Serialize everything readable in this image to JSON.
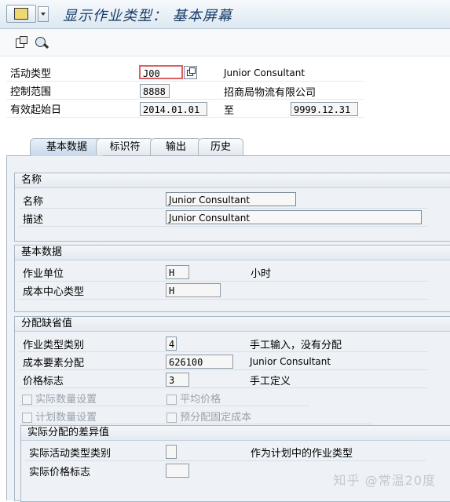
{
  "window": {
    "title": "显示作业类型： 基本屏幕"
  },
  "header": {
    "activity_type": {
      "label": "活动类型",
      "value": "J00",
      "text": "Junior Consultant"
    },
    "controlling_area": {
      "label": "控制范围",
      "value": "8888",
      "text": "招商局物流有限公司"
    },
    "valid_from": {
      "label": "有效起始日",
      "value": "2014.01.01",
      "to_label": "至",
      "to_value": "9999.12.31"
    }
  },
  "tabs": [
    {
      "label": "基本数据",
      "active": true
    },
    {
      "label": "标识符",
      "active": false
    },
    {
      "label": "输出",
      "active": false
    },
    {
      "label": "历史",
      "active": false
    }
  ],
  "group_name": {
    "title": "名称",
    "name_label": "名称",
    "name_value": "Junior Consultant",
    "desc_label": "描述",
    "desc_value": "Junior Consultant"
  },
  "group_basic": {
    "title": "基本数据",
    "unit_label": "作业单位",
    "unit_value": "H",
    "unit_text": "小时",
    "cc_type_label": "成本中心类型",
    "cc_type_value": "H"
  },
  "group_alloc": {
    "title": "分配缺省值",
    "cat_label": "作业类型类别",
    "cat_value": "4",
    "cat_text": "手工输入，没有分配",
    "elem_label": "成本要素分配",
    "elem_value": "626100",
    "elem_text": "Junior Consultant",
    "price_label": "价格标志",
    "price_value": "3",
    "price_text": "手工定义",
    "chk_actual_qty": "实际数量设置",
    "chk_avg_price": "平均价格",
    "chk_plan_qty": "计划数量设置",
    "chk_fixed_cost": "预分配固定成本"
  },
  "group_variance": {
    "title": "实际分配的差异值",
    "act_cat_label": "实际活动类型类别",
    "act_cat_value": "",
    "act_cat_text": "作为计划中的作业类型",
    "act_price_label": "实际价格标志",
    "act_price_value": ""
  },
  "watermark": "知乎 @常温20度"
}
